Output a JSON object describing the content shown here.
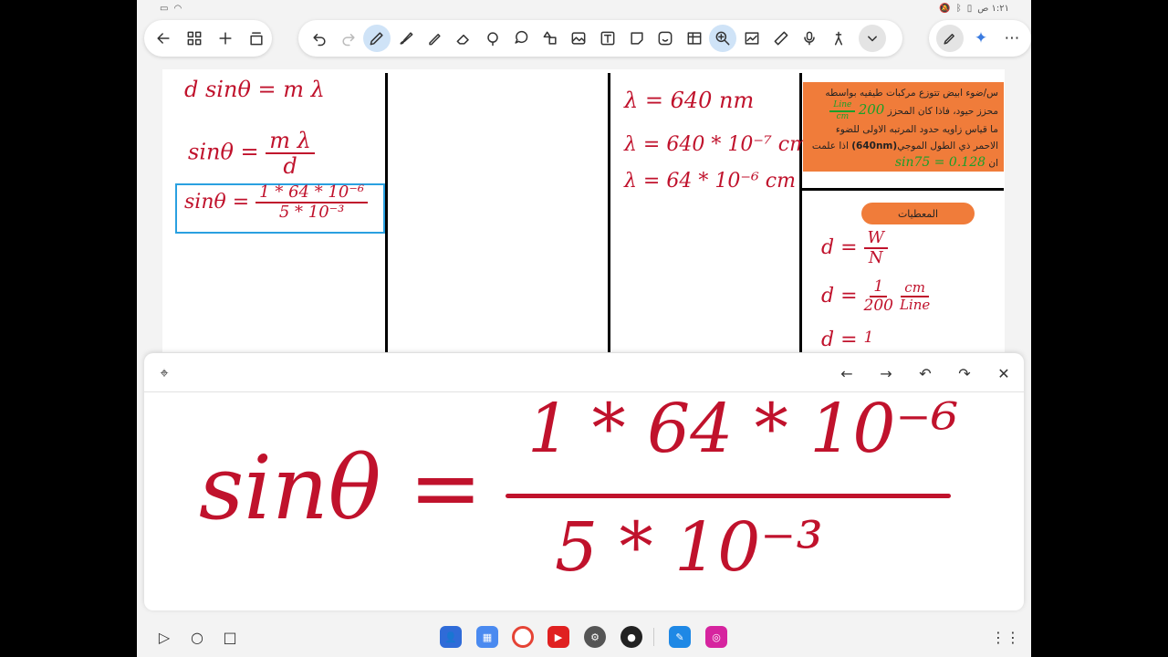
{
  "status": {
    "time": "١:٢١ ص"
  },
  "toolbar_icons": [
    "back-arrow-icon",
    "grid-icon",
    "plus-icon",
    "copy-pages-icon",
    "undo-icon",
    "redo-icon",
    "pen-icon",
    "brush-icon",
    "highlighter-icon",
    "eraser-icon",
    "lasso-icon",
    "shapes-icon",
    "image-icon",
    "text-icon",
    "sticky-note-icon",
    "sticker-icon",
    "table-icon",
    "zoom-icon",
    "chart-icon",
    "ruler-icon",
    "mic-icon",
    "laser-icon",
    "collapse-icon",
    "ai-pen-icon",
    "sparkle-icon",
    "more-icon"
  ],
  "colors": {
    "ink_red": "#c0122c",
    "ink_green": "#18a02a",
    "orange": "#f07c3a",
    "select_blue": "#2aa0e0"
  },
  "left_col": {
    "line1": "d sinθ = m λ",
    "line2_lhs": "sinθ =",
    "line2_num": "m λ",
    "line2_den": "d",
    "line3_lhs": "sinθ =",
    "line3_num": "1 * 64 * 10⁻⁶",
    "line3_den": "5 * 10⁻³"
  },
  "mid_col": {
    "line1": "λ = 640 nm",
    "line2": "λ = 640 * 10⁻⁷ cm",
    "line3": "λ = 64 * 10⁻⁶ cm"
  },
  "question": {
    "text_line1": "س/ضوء ابيض تتوزع مركبات طيفيه بواسطه",
    "text_line2": "محزز حيود، فاذا كان المحزز",
    "ink_200": "200",
    "ink_unit_num": "Line",
    "ink_unit_den": "cm",
    "text_line3": "ما قياس زاويه حدود المرتبه الاولى للضوء",
    "text_line4": "الاحمر ذي الطول الموجي",
    "wavelength": "(640nm)",
    "text_line4b": "اذا علمت",
    "text_line5": "ان",
    "ink_sin": "sin75 = 0.128"
  },
  "givens": {
    "label": "المعطيات",
    "d1_lhs": "d =",
    "d1_num": "W",
    "d1_den": "N",
    "d2_lhs": "d =",
    "d2_num": "1",
    "d2_den": "200",
    "d2_unit_num": "cm",
    "d2_unit_den": "Line",
    "d3_lhs": "d =",
    "d3_num": "1"
  },
  "zoom": {
    "lhs": "sinθ =",
    "num": "1 * 64 * 10⁻⁶",
    "den": "5 * 10⁻³"
  }
}
